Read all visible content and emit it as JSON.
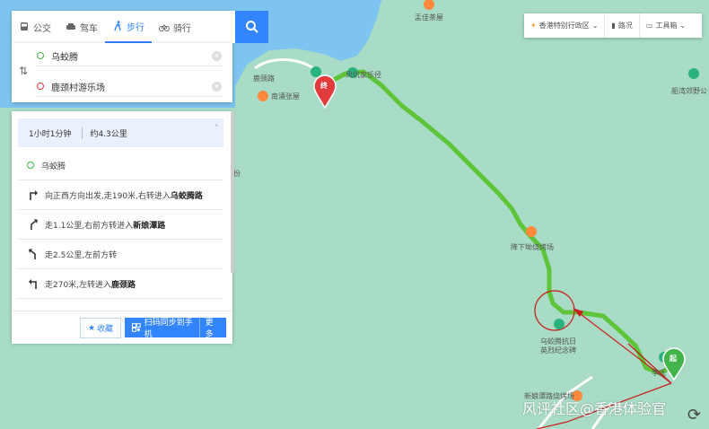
{
  "modes": [
    {
      "label": "公交",
      "icon": "bus-icon"
    },
    {
      "label": "驾车",
      "icon": "car-icon"
    },
    {
      "label": "步行",
      "icon": "walk-icon",
      "active": true
    },
    {
      "label": "骑行",
      "icon": "bike-icon"
    }
  ],
  "search": {
    "icon": "search-icon"
  },
  "endpoints": {
    "start": "乌蛟腾",
    "end": "鹿颈村游乐场"
  },
  "route": {
    "duration": "1小时1分钟",
    "distance": "约4.3公里",
    "start_name": "乌蛟腾",
    "steps": [
      {
        "pre": "向正西方向出发,走190米,右转进入",
        "bold": "乌蛟腾路",
        "icon": "turn-right-icon"
      },
      {
        "pre": "走1.1公里,右前方转进入",
        "bold": "新娘潭路",
        "icon": "slight-right-icon"
      },
      {
        "pre": "走2.5公里,左前方转",
        "bold": "",
        "icon": "slight-left-icon"
      },
      {
        "pre": "走270米,左转进入",
        "bold": "鹿颈路",
        "icon": "turn-left-icon"
      }
    ],
    "fav_label": "收藏",
    "scan_label": "扫码同步到手机",
    "more_label": "更多"
  },
  "toolbar": {
    "region": "香港特别行政区",
    "traffic": "路况",
    "tools": "工具箱"
  },
  "map_labels": {
    "top_place": "盂佳茶屋",
    "restaurant_left": "南涌张屋",
    "road_left": "鹿颈路",
    "trail": "凤坑家乐径",
    "bbq": "降下坳烧烤场",
    "memorial": "乌蛟腾抗日英烈纪念碑",
    "bbq_bottom": "新娘潭路烧烤场",
    "right_top": "船湾郊野公",
    "start_short": "李氏",
    "side_char": "份",
    "start_marker": "起",
    "end_marker": "终"
  },
  "watermark": "风评社区@香港体验官",
  "colors": {
    "route": "#5ec43a",
    "accent": "#3385ff",
    "annotation": "#c81e1e",
    "water": "#7ec4f0",
    "land": "#a8dcc6"
  }
}
